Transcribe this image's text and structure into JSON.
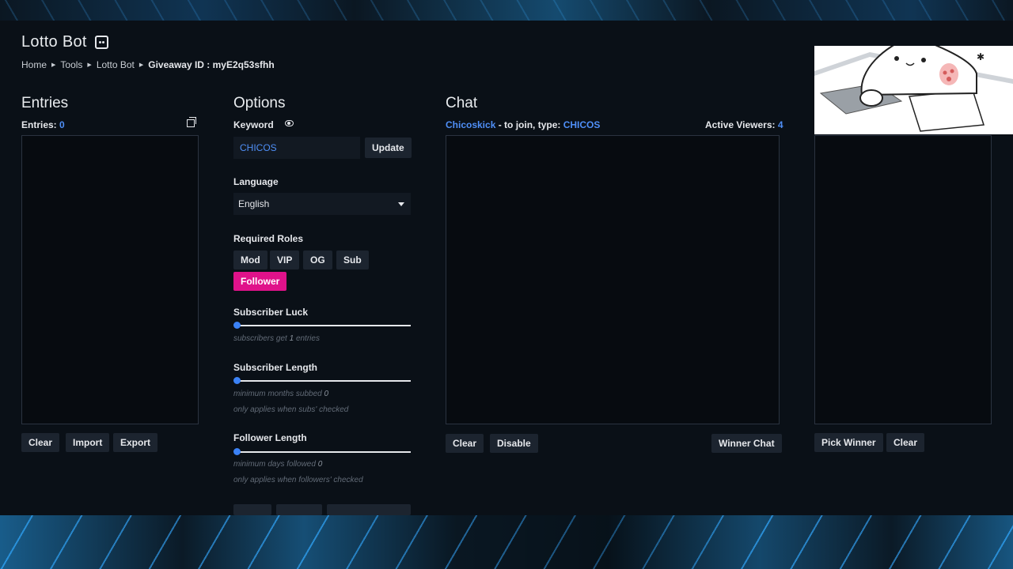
{
  "app": {
    "title": "Lotto Bot"
  },
  "breadcrumb": {
    "items": [
      "Home",
      "Tools",
      "Lotto Bot"
    ],
    "current": "Giveaway ID :  myE2q53sfhh"
  },
  "entries": {
    "title": "Entries",
    "count_label": "Entries:",
    "count": "0",
    "buttons": {
      "clear": "Clear",
      "import": "Import",
      "export": "Export"
    }
  },
  "options": {
    "title": "Options",
    "keyword_label": "Keyword",
    "keyword_value": "CHICOS",
    "update_label": "Update",
    "language_label": "Language",
    "language_value": "English",
    "required_roles_label": "Required Roles",
    "roles": [
      {
        "label": "Mod",
        "active": false
      },
      {
        "label": "VIP",
        "active": false
      },
      {
        "label": "OG",
        "active": false
      },
      {
        "label": "Sub",
        "active": false
      },
      {
        "label": "Follower",
        "active": true
      }
    ],
    "subscriber_luck": {
      "label": "Subscriber Luck",
      "value": 0,
      "hint_prefix": "subscribers get",
      "hint_value": "1",
      "hint_suffix": "entries"
    },
    "subscriber_length": {
      "label": "Subscriber Length",
      "value": 0,
      "hint_prefix": "minimum months subbed",
      "hint_value": "0",
      "note": "only applies when subs' checked"
    },
    "follower_length": {
      "label": "Follower Length",
      "value": 0,
      "hint_prefix": "minimum days followed",
      "hint_value": "0",
      "note": "only applies when followers' checked"
    }
  },
  "chat": {
    "title": "Chat",
    "channel": "Chicoskick",
    "join_text": " - to join, type: ",
    "keyword": "CHICOS",
    "viewers_label": "Active Viewers:",
    "viewers_count": "4",
    "buttons": {
      "clear": "Clear",
      "disable": "Disable",
      "winner_chat": "Winner Chat"
    }
  },
  "winner": {
    "buttons": {
      "pick": "Pick Winner",
      "clear": "Clear"
    }
  },
  "colors": {
    "accent": "#4f8ff7",
    "active_role": "#e0128a",
    "slider": "#3b82f6"
  }
}
